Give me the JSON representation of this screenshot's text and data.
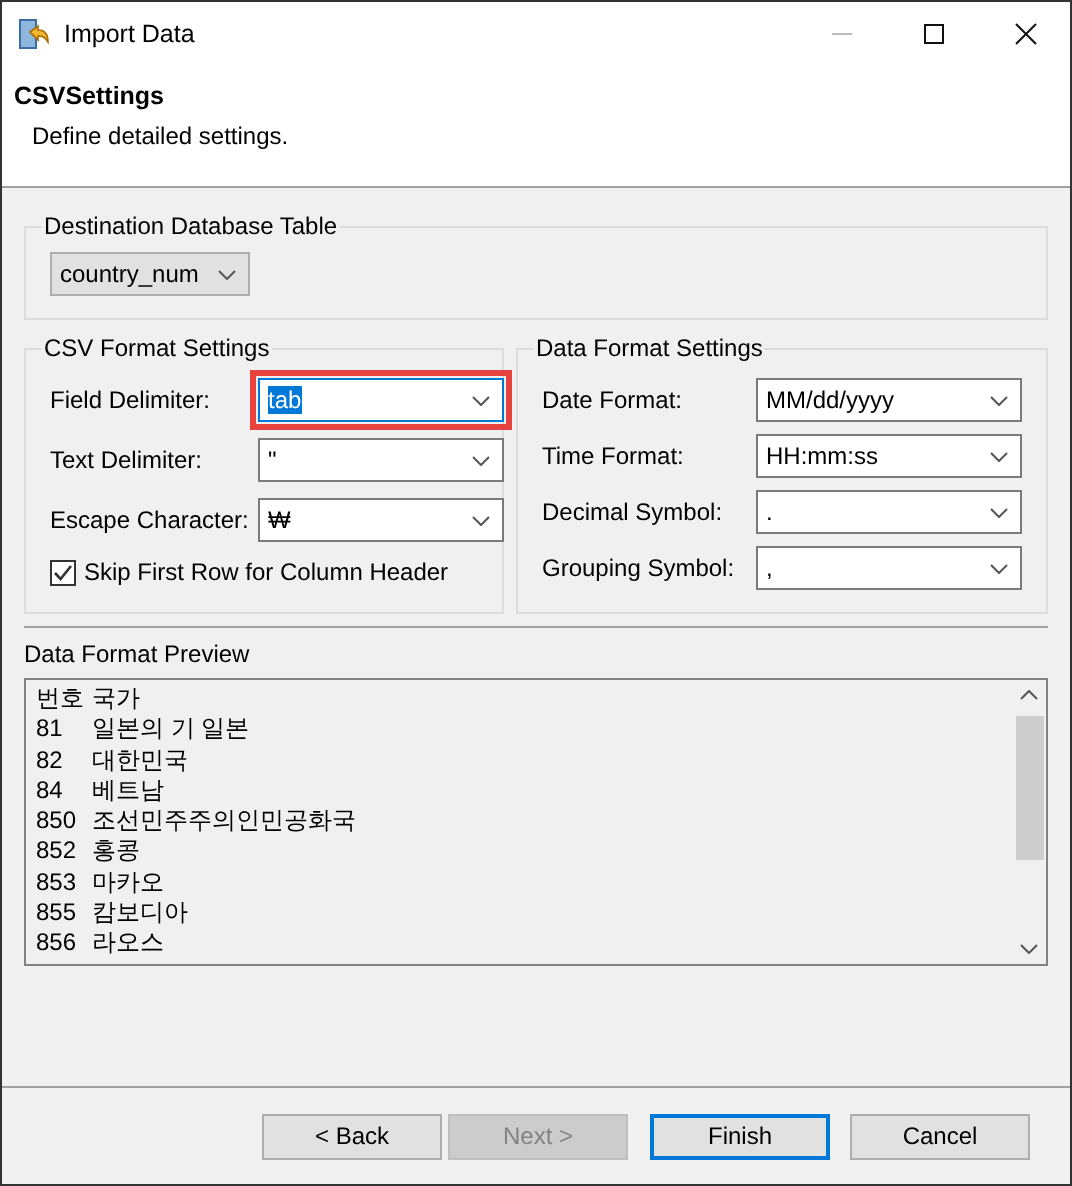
{
  "window": {
    "title": "Import Data"
  },
  "header": {
    "title": "CSVSettings",
    "description": "Define detailed settings."
  },
  "destination": {
    "legend": "Destination Database Table",
    "table": "country_num"
  },
  "csv_format": {
    "legend": "CSV Format Settings",
    "fields": [
      {
        "label": "Field Delimiter:",
        "value": "tab",
        "focused": true,
        "highlighted": true
      },
      {
        "label": "Text Delimiter:",
        "value": "\"",
        "focused": false,
        "highlighted": false
      },
      {
        "label": "Escape Character:",
        "value": "₩",
        "focused": false,
        "highlighted": false
      }
    ],
    "skip_header": {
      "label": "Skip First Row for Column Header",
      "checked": true
    }
  },
  "data_format": {
    "legend": "Data Format Settings",
    "fields": [
      {
        "label": "Date Format:",
        "value": "MM/dd/yyyy"
      },
      {
        "label": "Time Format:",
        "value": "HH:mm:ss"
      },
      {
        "label": "Decimal Symbol:",
        "value": "."
      },
      {
        "label": "Grouping Symbol:",
        "value": ","
      }
    ]
  },
  "preview": {
    "label": "Data Format Preview",
    "rows": [
      {
        "code": "번호",
        "name": "국가"
      },
      {
        "code": "81",
        "name": "일본의 기 일본"
      },
      {
        "code": "82",
        "name": "대한민국"
      },
      {
        "code": "84",
        "name": "베트남"
      },
      {
        "code": "850",
        "name": "조선민주주의인민공화국"
      },
      {
        "code": "852",
        "name": "홍콩"
      },
      {
        "code": "853",
        "name": "마카오"
      },
      {
        "code": "855",
        "name": "캄보디아"
      },
      {
        "code": "856",
        "name": "라오스"
      }
    ]
  },
  "buttons": [
    {
      "label": "< Back",
      "disabled": false,
      "default": false
    },
    {
      "label": "Next >",
      "disabled": true,
      "default": false
    },
    {
      "label": "Finish",
      "disabled": false,
      "default": true
    },
    {
      "label": "Cancel",
      "disabled": false,
      "default": false
    }
  ]
}
